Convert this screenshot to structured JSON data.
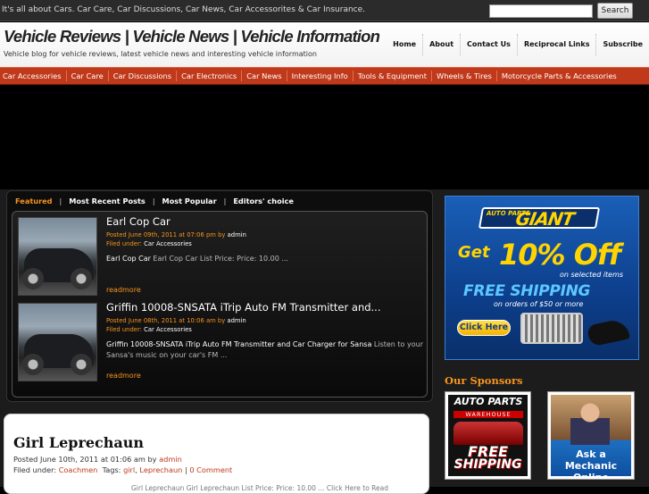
{
  "topbar": {
    "tagline": "It's all about Cars. Car Care, Car Discussions, Car News, Car Accessorites & Car Insurance.",
    "search_placeholder": "",
    "search_button": "Search"
  },
  "header": {
    "title": "Vehicle Reviews | Vehicle News | Vehicle Information",
    "description": "Vehicle blog for vehicle reviews, latest vehicle news and interesting vehicle information",
    "nav": [
      "Home",
      "About",
      "Contact Us",
      "Reciprocal Links",
      "Subscribe"
    ]
  },
  "categories": [
    "Car Accessories",
    "Car Care",
    "Car Discussions",
    "Car Electronics",
    "Car News",
    "Interesting Info",
    "Tools & Equipment",
    "Wheels & Tires",
    "Motorcycle Parts & Accessories"
  ],
  "featured": {
    "tabs": [
      "Featured",
      "Most Recent Posts",
      "Most Popular",
      "Editors' choice"
    ],
    "items": [
      {
        "title": "Earl Cop Car",
        "posted_prefix": "Posted June 09th, 2011 at 07:06 pm by",
        "author": "admin",
        "filed_prefix": "Filed under:",
        "category": "Car Accessories",
        "excerpt_bold": "Earl Cop Car",
        "excerpt_rest": " Earl Cop Car List Price: Price: 10.00 ...",
        "readmore": "readmore"
      },
      {
        "title": "Griffin 10008-SNSATA iTrip Auto FM Transmitter and...",
        "posted_prefix": "Posted June 08th, 2011 at 10:06 am by",
        "author": "admin",
        "filed_prefix": "Filed under:",
        "category": "Car Accessories",
        "excerpt_bold": "Griffin 10008-SNSATA iTrip Auto FM Transmitter and Car Charger for Sansa",
        "excerpt_rest": " Listen to your Sansa's music on your car's FM ...",
        "readmore": "readmore"
      }
    ]
  },
  "post": {
    "title": "Girl Leprechaun",
    "posted_prefix": "Posted June 10th, 2011 at 01:06 am by",
    "author": "admin",
    "filed_prefix": "Filed under:",
    "category": "Coachmen",
    "tags_label": "Tags:",
    "tag1": "girl",
    "tag2": "Leprechaun",
    "comments": "0 Comment",
    "excerpt": "Girl Leprechaun Girl Leprechaun List Price: Price: 10.00 ...   Click Here to Read"
  },
  "sidebar": {
    "ad": {
      "logo_small": "AUTO PARTS",
      "logo_big": "GIANT",
      "get": "Get",
      "percent": "10% Off",
      "selected": "on selected items",
      "free_shipping": "FREE SHIPPING",
      "orders": "on orders of $50 or more",
      "click": "Click Here"
    },
    "sponsors_heading": "Our Sponsors",
    "sponsor1": {
      "line1": "AUTO PARTS",
      "line2": "WAREHOUSE",
      "free": "FREE",
      "shipping": "SHIPPING"
    },
    "sponsor2": {
      "text": "Ask a Mechanic Online"
    }
  }
}
